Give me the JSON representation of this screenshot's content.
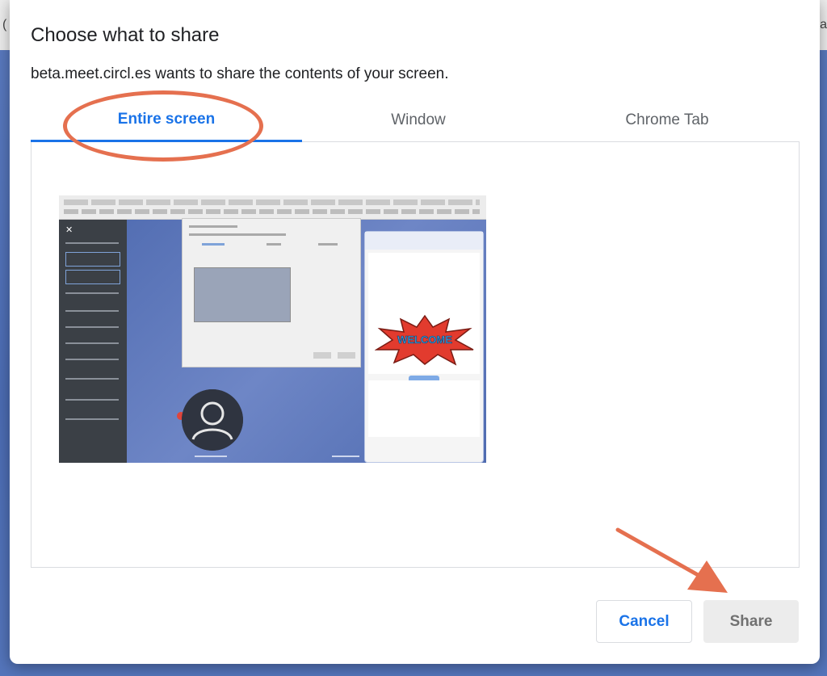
{
  "dialog": {
    "title": "Choose what to share",
    "subtitle": "beta.meet.circl.es wants to share the contents of your screen."
  },
  "tabs": [
    {
      "label": "Entire screen",
      "active": true
    },
    {
      "label": "Window",
      "active": false
    },
    {
      "label": "Chrome Tab",
      "active": false
    }
  ],
  "preview": {
    "icon": "screen-thumbnail",
    "burst_text": "WELCOME"
  },
  "buttons": {
    "cancel_label": "Cancel",
    "share_label": "Share"
  },
  "colors": {
    "accent": "#1a73e8",
    "annotation": "#e5704f",
    "backdrop": "#5473b9"
  }
}
